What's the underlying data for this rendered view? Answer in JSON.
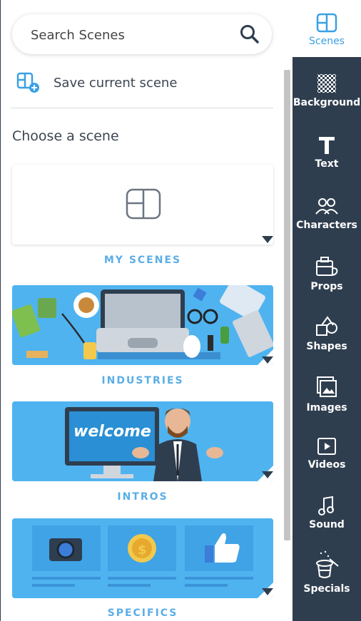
{
  "search": {
    "placeholder": "Search Scenes"
  },
  "save": {
    "label": "Save current scene"
  },
  "choose_label": "Choose a scene",
  "cards": [
    {
      "title": "MY SCENES"
    },
    {
      "title": "INDUSTRIES"
    },
    {
      "title": "INTROS",
      "screen_text": "welcome"
    },
    {
      "title": "SPECIFICS"
    }
  ],
  "sidebar": {
    "items": [
      {
        "label": "Scenes",
        "icon": "scenes-icon",
        "active": true
      },
      {
        "label": "Background",
        "icon": "checker-icon"
      },
      {
        "label": "Text",
        "icon": "text-icon"
      },
      {
        "label": "Characters",
        "icon": "characters-icon"
      },
      {
        "label": "Props",
        "icon": "props-icon"
      },
      {
        "label": "Shapes",
        "icon": "shapes-icon"
      },
      {
        "label": "Images",
        "icon": "images-icon"
      },
      {
        "label": "Videos",
        "icon": "videos-icon"
      },
      {
        "label": "Sound",
        "icon": "sound-icon"
      },
      {
        "label": "Specials",
        "icon": "magic-hat-icon"
      }
    ]
  },
  "colors": {
    "accent": "#3aa0e6",
    "sidebar_bg": "#2f3e4f",
    "card_blue": "#4fb3f0"
  }
}
